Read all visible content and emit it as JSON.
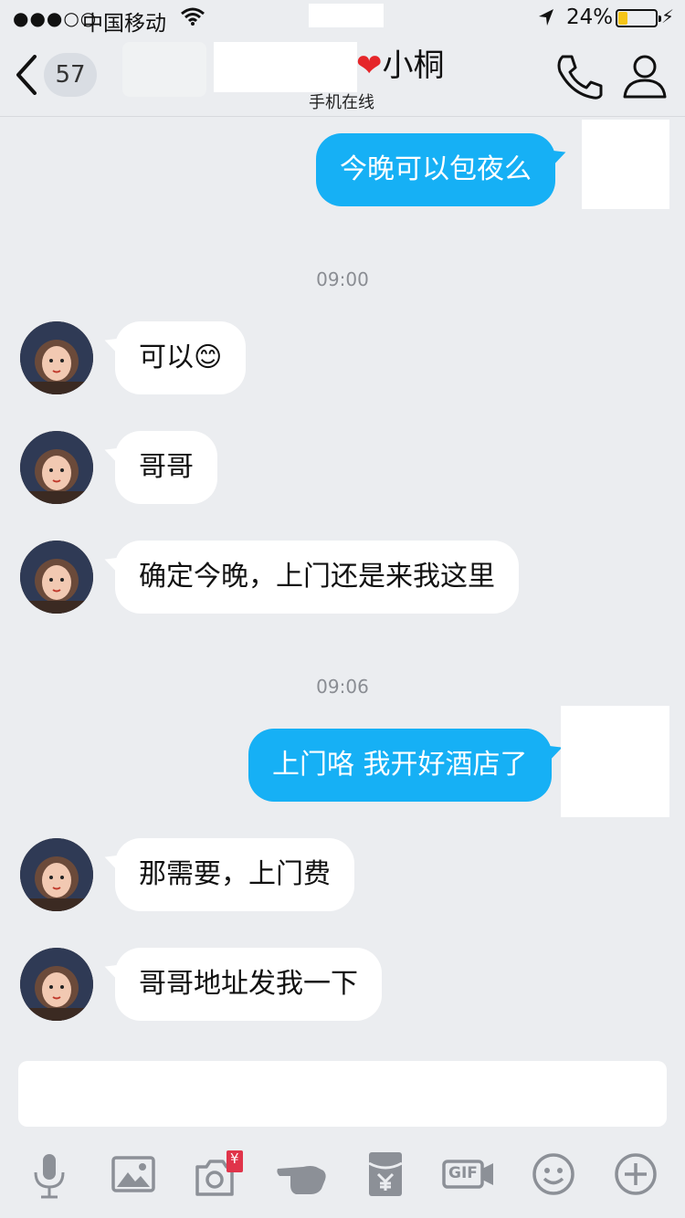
{
  "status_bar": {
    "signal": "●●●○○",
    "carrier": "中国移动",
    "battery_pct": "24%",
    "battery_level": 0.24,
    "icons": [
      "wifi-icon",
      "location-arrow-icon",
      "battery-icon",
      "charging-bolt-icon"
    ]
  },
  "nav": {
    "unread_count": "57",
    "title": "小桐",
    "heart": "❤",
    "subtitle": "手机在线",
    "icons": [
      "back-chevron-icon",
      "phone-icon",
      "person-icon"
    ]
  },
  "messages": {
    "m1": "今晚可以包夜么",
    "t1": "09:00",
    "m2": "可以",
    "m2_emoji": "😊",
    "m3": "哥哥",
    "m4": "确定今晚，上门还是来我这里",
    "t2": "09:06",
    "m5": "上门咯 我开好酒店了",
    "m6": "那需要，上门费",
    "m7": "哥哥地址发我一下"
  },
  "input": {
    "placeholder": ""
  },
  "toolbar": {
    "icons": [
      "microphone-icon",
      "image-icon",
      "camera-redpacket-icon",
      "poke-hand-icon",
      "red-packet-icon",
      "gif-icon",
      "emoji-face-icon",
      "plus-icon"
    ],
    "redpacket_symbol": "¥",
    "gif_label": "GIF"
  },
  "colors": {
    "outgoing_bubble": "#16b0f5",
    "incoming_bubble": "#ffffff",
    "background": "#ebedf0",
    "icon_gray": "#8c9097"
  }
}
